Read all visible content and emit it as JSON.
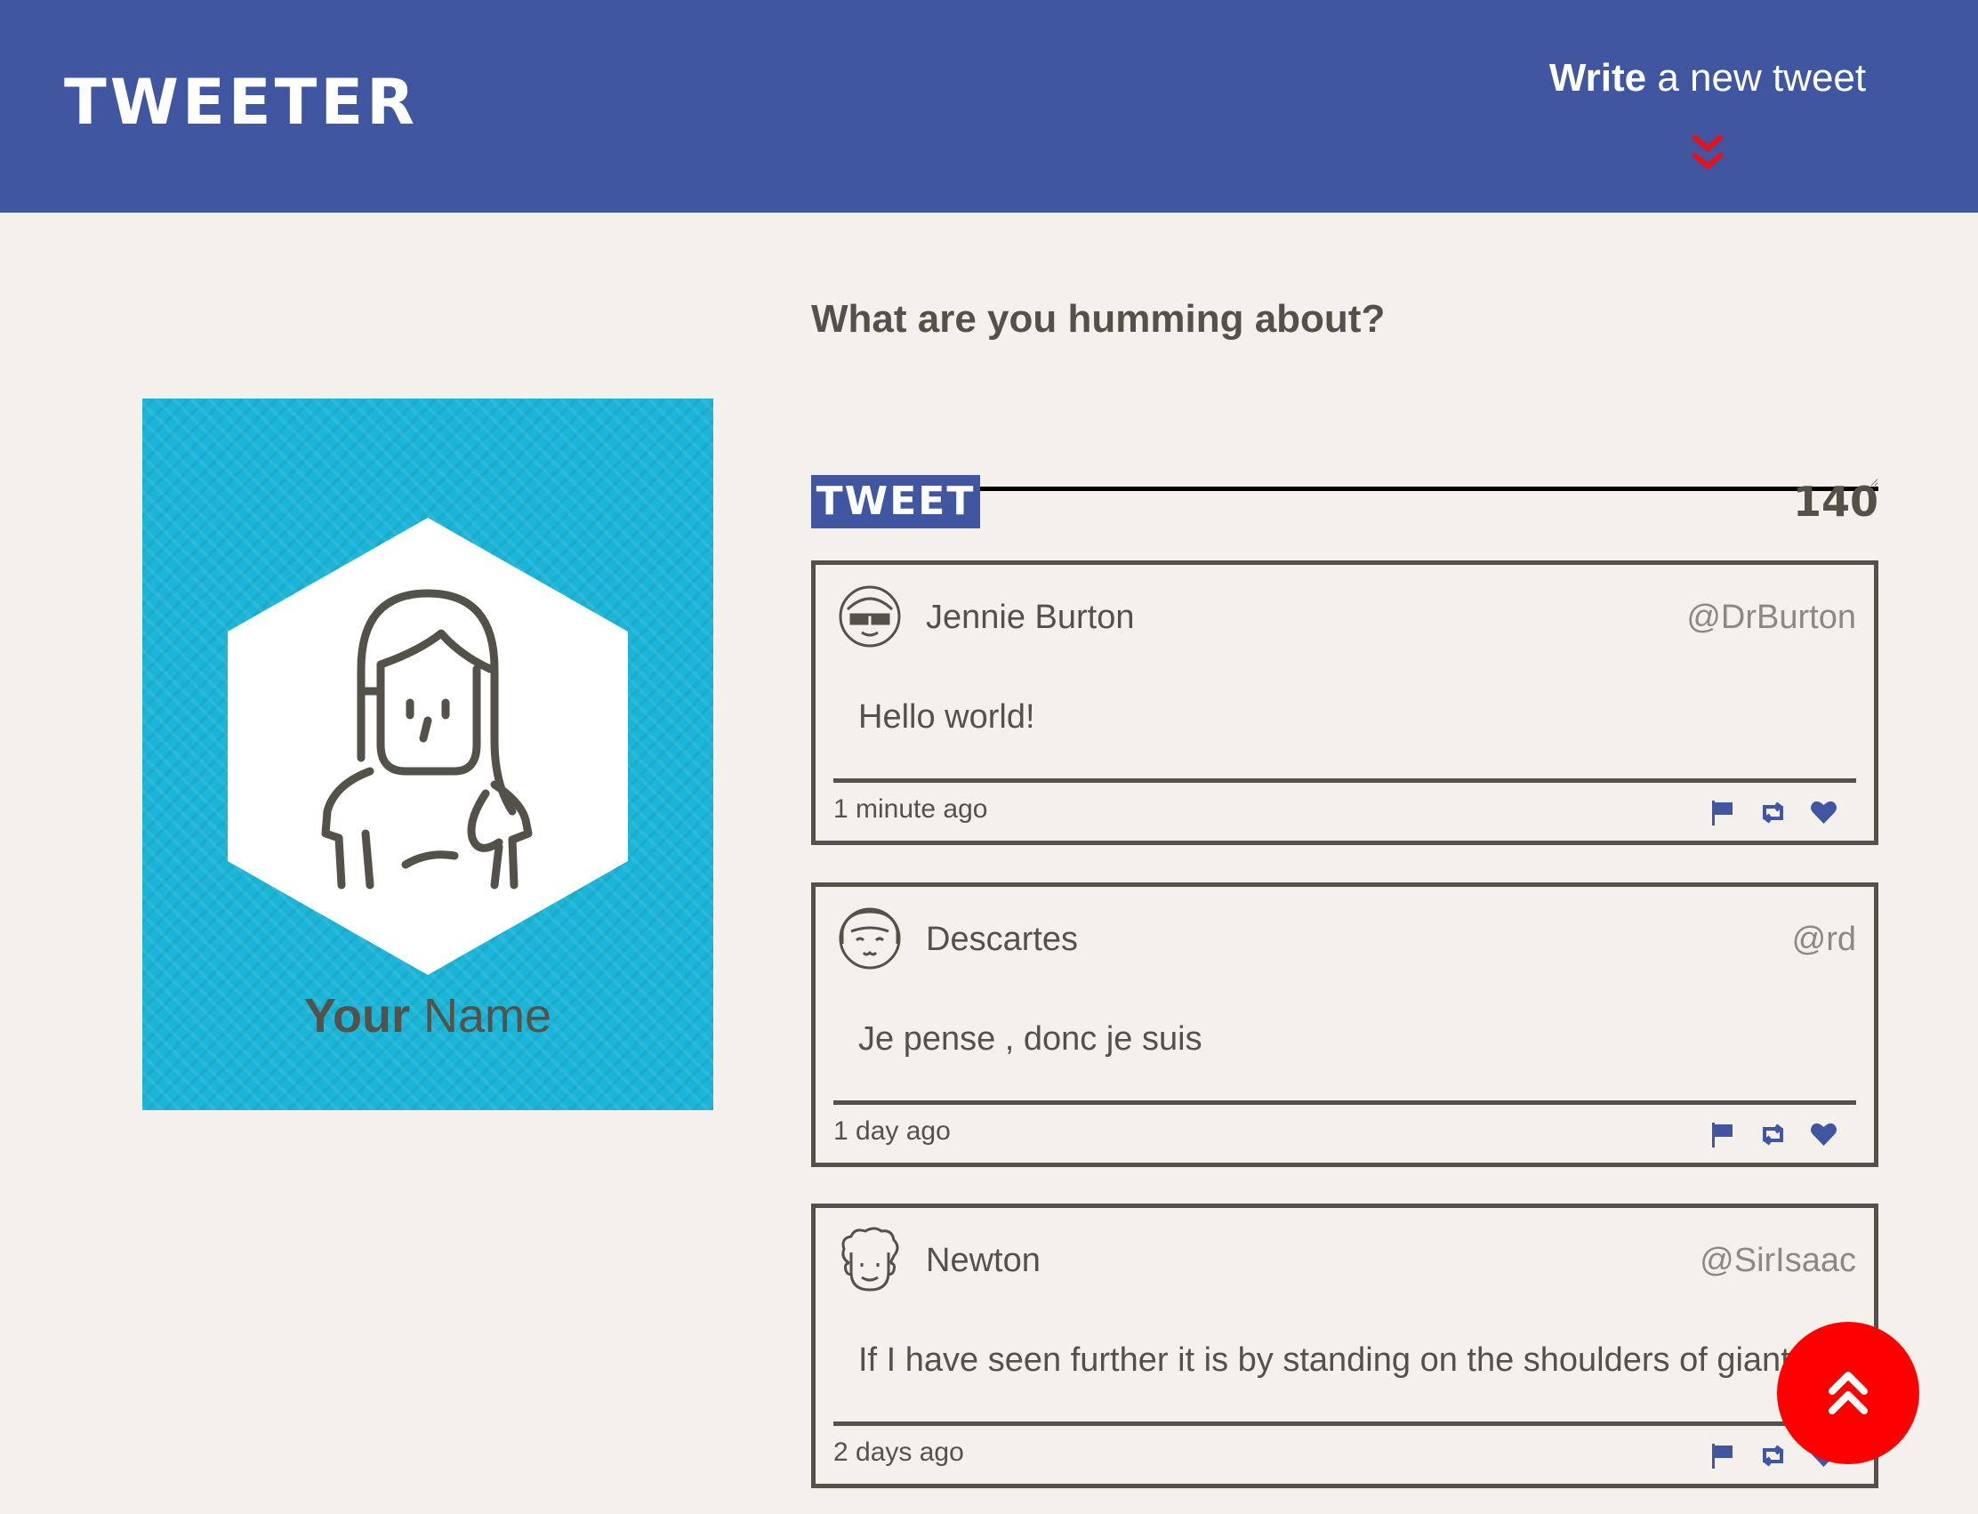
{
  "nav": {
    "brand": "TWEETER",
    "compose_strong": "Write",
    "compose_rest": " a new tweet",
    "chevron_icon": "double-chevron-down-icon"
  },
  "profile": {
    "name_first": "Your",
    "name_rest": " Name",
    "avatar_icon": "woman-avatar-icon"
  },
  "composer": {
    "label": "What are you humming about?",
    "tweet_value": "",
    "button_label": "TWEET",
    "counter": "140"
  },
  "tweets": [
    {
      "name": "Jennie Burton",
      "handle": "@DrBurton",
      "content": "Hello world!",
      "time": "1 minute ago",
      "avatar_icon": "sunglasses-avatar-icon"
    },
    {
      "name": "Descartes",
      "handle": "@rd",
      "content": "Je pense , donc je suis",
      "time": "1 day ago",
      "avatar_icon": "smiling-avatar-icon"
    },
    {
      "name": "Newton",
      "handle": "@SirIsaac",
      "content": "If I have seen further it is by standing on the shoulders of giants",
      "time": "2 days ago",
      "avatar_icon": "curly-hair-avatar-icon"
    }
  ],
  "actions": [
    "flag-icon",
    "retweet-icon",
    "heart-icon"
  ],
  "colors": {
    "nav_bg": "#4056a1",
    "page_bg": "#f4f1ec",
    "text": "#545149",
    "profile_bg": "#1bb5d8",
    "accent_red": "#ff0000"
  },
  "scroll_top_icon": "double-chevron-up-icon"
}
